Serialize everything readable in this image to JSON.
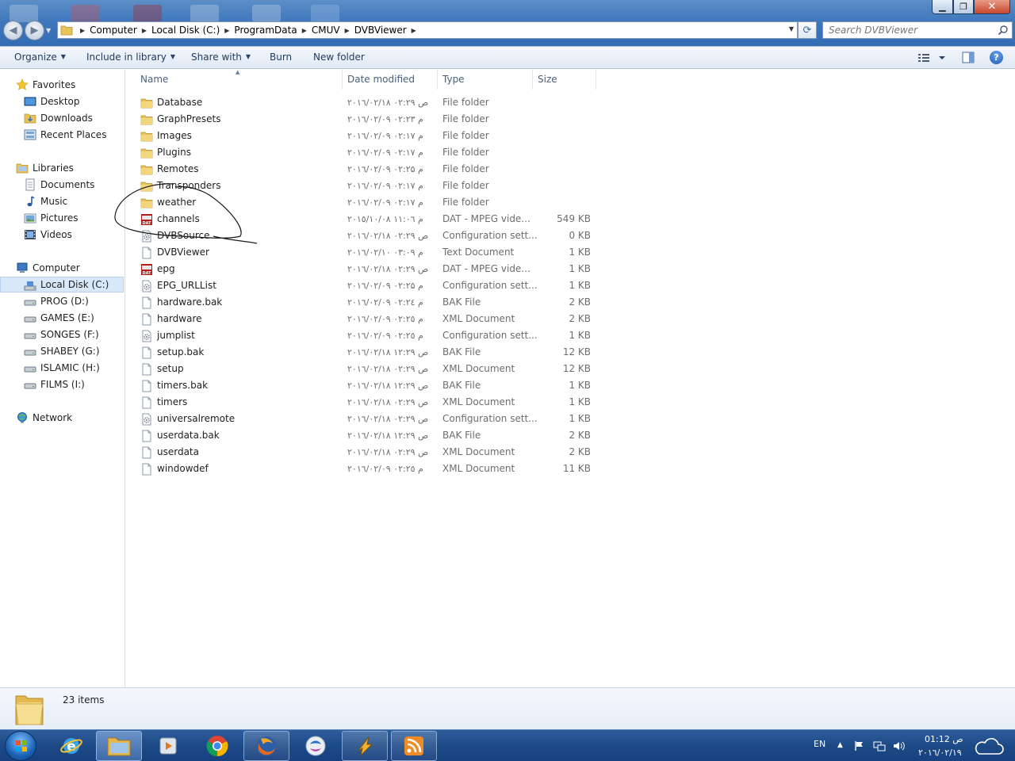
{
  "window": {
    "minimize_glyph": "▁",
    "maximize_glyph": "❐",
    "close_glyph": "✕"
  },
  "navigation": {
    "back_glyph": "◀",
    "forward_glyph": "▶",
    "breadcrumbs": [
      "Computer",
      "Local Disk (C:)",
      "ProgramData",
      "CMUV",
      "DVBViewer"
    ],
    "refresh_glyph": "⟳"
  },
  "search": {
    "placeholder": "Search DVBViewer"
  },
  "toolbar": {
    "organize": "Organize",
    "include_in_library": "Include in library",
    "share_with": "Share with",
    "burn": "Burn",
    "new_folder": "New folder",
    "help": "?"
  },
  "sidebar": {
    "favorites": {
      "label": "Favorites",
      "items": [
        "Desktop",
        "Downloads",
        "Recent Places"
      ]
    },
    "libraries": {
      "label": "Libraries",
      "items": [
        "Documents",
        "Music",
        "Pictures",
        "Videos"
      ]
    },
    "computer": {
      "label": "Computer",
      "items": [
        "Local Disk (C:)",
        "PROG (D:)",
        "GAMES (E:)",
        "SONGES (F:)",
        "SHABEY (G:)",
        "ISLAMIC (H:)",
        "FILMS (I:)"
      ],
      "selected": "Local Disk (C:)"
    },
    "network": {
      "label": "Network"
    }
  },
  "columns": {
    "name": "Name",
    "date_modified": "Date modified",
    "type": "Type",
    "size": "Size"
  },
  "files": [
    {
      "name": "Database",
      "date": "۲۰۱٦/۰۲/۱۸ ص ۰۲:۲۹",
      "type": "File folder",
      "size": "",
      "icon": "folder-icon"
    },
    {
      "name": "GraphPresets",
      "date": "۲۰۱٦/۰۲/۰۹ م ۰۲:۲۳",
      "type": "File folder",
      "size": "",
      "icon": "folder-icon"
    },
    {
      "name": "Images",
      "date": "۲۰۱٦/۰۲/۰۹ م ۰۲:۱۷",
      "type": "File folder",
      "size": "",
      "icon": "folder-icon"
    },
    {
      "name": "Plugins",
      "date": "۲۰۱٦/۰۲/۰۹ م ۰۲:۱۷",
      "type": "File folder",
      "size": "",
      "icon": "folder-icon"
    },
    {
      "name": "Remotes",
      "date": "۲۰۱٦/۰۲/۰۹ م ۰۲:۲۵",
      "type": "File folder",
      "size": "",
      "icon": "folder-icon"
    },
    {
      "name": "Transponders",
      "date": "۲۰۱٦/۰۲/۰۹ م ۰۲:۱۷",
      "type": "File folder",
      "size": "",
      "icon": "folder-icon"
    },
    {
      "name": "weather",
      "date": "۲۰۱٦/۰۲/۰۹ م ۰۲:۱۷",
      "type": "File folder",
      "size": "",
      "icon": "folder-icon"
    },
    {
      "name": "channels",
      "date": "۲۰۱٥/۱۰/۰۸ م ۱۱:۰٦",
      "type": "DAT - MPEG vide...",
      "size": "549 KB",
      "icon": "dat-file-icon"
    },
    {
      "name": "DVBSource",
      "date": "۲۰۱٦/۰۲/۱۸ ص ۰۲:۲۹",
      "type": "Configuration sett...",
      "size": "0 KB",
      "icon": "config-file-icon"
    },
    {
      "name": "DVBViewer",
      "date": "۲۰۱٦/۰۲/۱۰ م ۰۳:۰۹",
      "type": "Text Document",
      "size": "1 KB",
      "icon": "document-icon"
    },
    {
      "name": "epg",
      "date": "۲۰۱٦/۰۲/۱۸ ص ۰۲:۲۹",
      "type": "DAT - MPEG vide...",
      "size": "1 KB",
      "icon": "dat-file-icon"
    },
    {
      "name": "EPG_URLList",
      "date": "۲۰۱٦/۰۲/۰۹ م ۰۲:۲۵",
      "type": "Configuration sett...",
      "size": "1 KB",
      "icon": "config-file-icon"
    },
    {
      "name": "hardware.bak",
      "date": "۲۰۱٦/۰۲/۰۹ م ۰۲:۲٤",
      "type": "BAK File",
      "size": "2 KB",
      "icon": "document-icon"
    },
    {
      "name": "hardware",
      "date": "۲۰۱٦/۰۲/۰۹ م ۰۲:۲٥",
      "type": "XML Document",
      "size": "2 KB",
      "icon": "document-icon"
    },
    {
      "name": "jumplist",
      "date": "۲۰۱٦/۰۲/۰۹ م ۰۲:۲٥",
      "type": "Configuration sett...",
      "size": "1 KB",
      "icon": "config-file-icon"
    },
    {
      "name": "setup.bak",
      "date": "۲۰۱٦/۰۲/۱۸ ص ۱۲:۲۹",
      "type": "BAK File",
      "size": "12 KB",
      "icon": "document-icon"
    },
    {
      "name": "setup",
      "date": "۲۰۱٦/۰۲/۱۸ ص ۰۲:۲۹",
      "type": "XML Document",
      "size": "12 KB",
      "icon": "document-icon"
    },
    {
      "name": "timers.bak",
      "date": "۲۰۱٦/۰۲/۱۸ ص ۱۲:۲۹",
      "type": "BAK File",
      "size": "1 KB",
      "icon": "document-icon"
    },
    {
      "name": "timers",
      "date": "۲۰۱٦/۰۲/۱۸ ص ۰۲:۲۹",
      "type": "XML Document",
      "size": "1 KB",
      "icon": "document-icon"
    },
    {
      "name": "universalremote",
      "date": "۲۰۱٦/۰۲/۱۸ ص ۰۲:۲۹",
      "type": "Configuration sett...",
      "size": "1 KB",
      "icon": "config-file-icon"
    },
    {
      "name": "userdata.bak",
      "date": "۲۰۱٦/۰۲/۱۸ ص ۱۲:۲۹",
      "type": "BAK File",
      "size": "2 KB",
      "icon": "document-icon"
    },
    {
      "name": "userdata",
      "date": "۲۰۱٦/۰۲/۱۸ ص ۰۲:۲۹",
      "type": "XML Document",
      "size": "2 KB",
      "icon": "document-icon"
    },
    {
      "name": "windowdef",
      "date": "۲۰۱٦/۰۲/۰۹ م ۰۲:۲٥",
      "type": "XML Document",
      "size": "11 KB",
      "icon": "document-icon"
    }
  ],
  "status": {
    "item_count": "23 items"
  },
  "taskbar": {
    "apps": [
      "internet-explorer-icon",
      "windows-explorer-icon",
      "media-player-icon",
      "chrome-icon",
      "firefox-icon",
      "messenger-icon",
      "winamp-icon",
      "rss-icon"
    ],
    "language": "EN",
    "time": "01:12 ص",
    "date": "۲۰۱٦/۰۲/۱۹"
  },
  "colors": {
    "title_bar": "#3f78bd",
    "selection": "#d9e8f9",
    "folder": "#e8c25a",
    "dat_icon": "#b3201c",
    "taskbar": "#1d4a86"
  }
}
